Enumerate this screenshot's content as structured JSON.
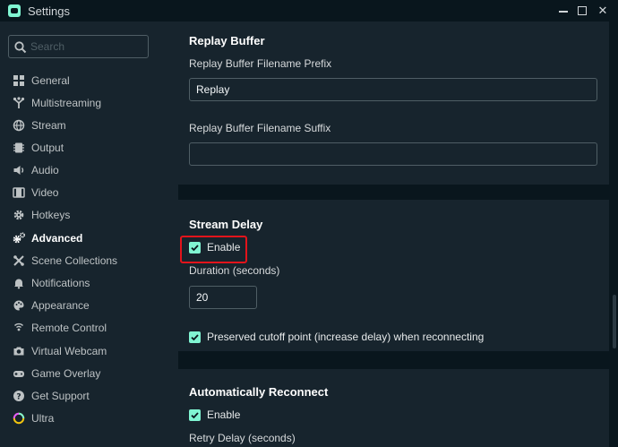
{
  "window": {
    "title": "Settings",
    "minimize_label": "minimize",
    "maximize_label": "maximize",
    "close_glyph": "✕"
  },
  "search": {
    "placeholder": "Search",
    "value": ""
  },
  "sidebar": {
    "active": "Advanced",
    "items": [
      {
        "label": "General",
        "icon": "grid-icon"
      },
      {
        "label": "Multistreaming",
        "icon": "fork-icon"
      },
      {
        "label": "Stream",
        "icon": "globe-icon"
      },
      {
        "label": "Output",
        "icon": "chip-icon"
      },
      {
        "label": "Audio",
        "icon": "speaker-icon"
      },
      {
        "label": "Video",
        "icon": "film-icon"
      },
      {
        "label": "Hotkeys",
        "icon": "gear-icon"
      },
      {
        "label": "Advanced",
        "icon": "gears-icon"
      },
      {
        "label": "Scene Collections",
        "icon": "sliders-icon"
      },
      {
        "label": "Notifications",
        "icon": "bell-icon"
      },
      {
        "label": "Appearance",
        "icon": "palette-icon"
      },
      {
        "label": "Remote Control",
        "icon": "remote-icon"
      },
      {
        "label": "Virtual Webcam",
        "icon": "camera-icon"
      },
      {
        "label": "Game Overlay",
        "icon": "gamepad-icon"
      },
      {
        "label": "Get Support",
        "icon": "question-icon"
      },
      {
        "label": "Ultra",
        "icon": "ultra-icon"
      }
    ]
  },
  "replay_buffer": {
    "title": "Replay Buffer",
    "prefix_label": "Replay Buffer Filename Prefix",
    "prefix_value": "Replay",
    "suffix_label": "Replay Buffer Filename Suffix",
    "suffix_value": ""
  },
  "stream_delay": {
    "title": "Stream Delay",
    "enable_label": "Enable",
    "enable_checked": true,
    "duration_label": "Duration (seconds)",
    "duration_value": "20",
    "preserve_label": "Preserved cutoff point (increase delay) when reconnecting",
    "preserve_checked": true
  },
  "auto_reconnect": {
    "title": "Automatically Reconnect",
    "enable_label": "Enable",
    "enable_checked": true,
    "retry_label": "Retry Delay (seconds)"
  },
  "colors": {
    "accent": "#80f5d2",
    "highlight": "#e3141b",
    "panel": "#17242d",
    "background": "#09161d"
  }
}
